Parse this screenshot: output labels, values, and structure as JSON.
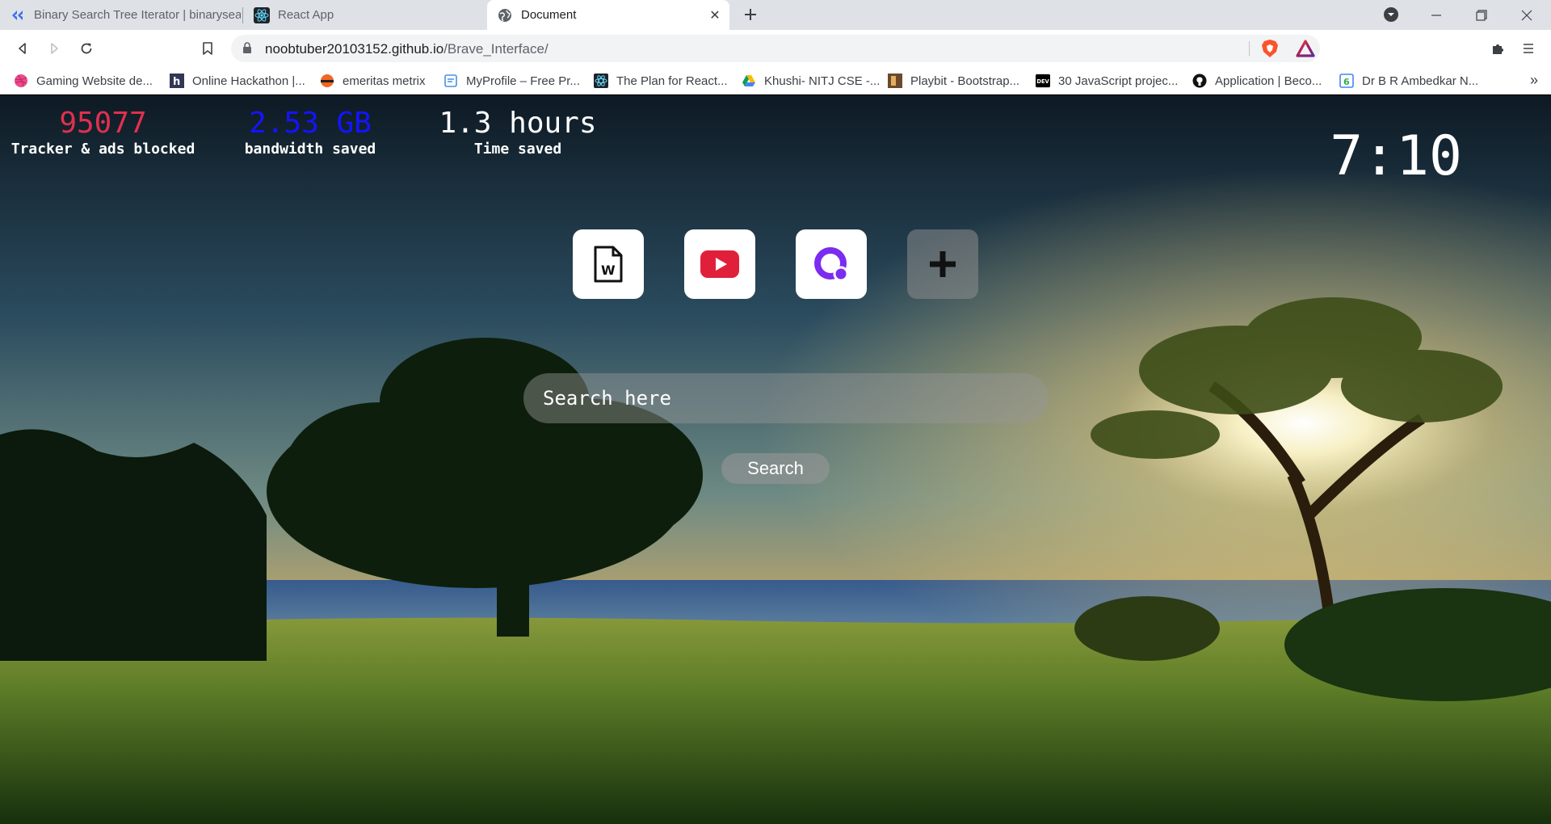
{
  "browser": {
    "tabs": [
      {
        "title": "Binary Search Tree Iterator | binarysea",
        "active": false,
        "icon": "binarysearch-favicon"
      },
      {
        "title": "React App",
        "active": false,
        "icon": "react-favicon"
      },
      {
        "title": "Document",
        "active": true,
        "icon": "globe-icon"
      }
    ],
    "url_host": "noobtuber20103152.github.io",
    "url_path": "/Brave_Interface/"
  },
  "bookmarks": [
    {
      "label": "Gaming Website de...",
      "icon": "dribbble-icon"
    },
    {
      "label": "Online Hackathon |...",
      "icon": "hackerearth-icon"
    },
    {
      "label": "emeritas metrix",
      "icon": "emeritas-icon"
    },
    {
      "label": "MyProfile – Free Pr...",
      "icon": "page-icon"
    },
    {
      "label": "The Plan for React...",
      "icon": "react-icon"
    },
    {
      "label": "Khushi- NITJ CSE -...",
      "icon": "google-drive-icon"
    },
    {
      "label": "Playbit - Bootstrap...",
      "icon": "playbit-icon"
    },
    {
      "label": "30 JavaScript projec...",
      "icon": "dev-icon"
    },
    {
      "label": "Application | Beco...",
      "icon": "github-icon"
    },
    {
      "label": "Dr B R Ambedkar N...",
      "icon": "google-sites-icon"
    }
  ],
  "stats": {
    "trackers": {
      "value": "95077",
      "label": "Tracker & ads blocked",
      "color": "#e0304e"
    },
    "bandwidth": {
      "value": "2.53 GB",
      "label": "bandwidth saved",
      "color": "#1414ff"
    },
    "time": {
      "value": "1.3 hours",
      "label": "Time saved",
      "color": "#ffffff"
    }
  },
  "clock": "7:10",
  "shortcuts": [
    {
      "name": "word-doc-icon"
    },
    {
      "name": "youtube-icon"
    },
    {
      "name": "quora-icon"
    },
    {
      "name": "add-icon"
    }
  ],
  "search": {
    "placeholder": "Search here",
    "button_label": "Search"
  }
}
